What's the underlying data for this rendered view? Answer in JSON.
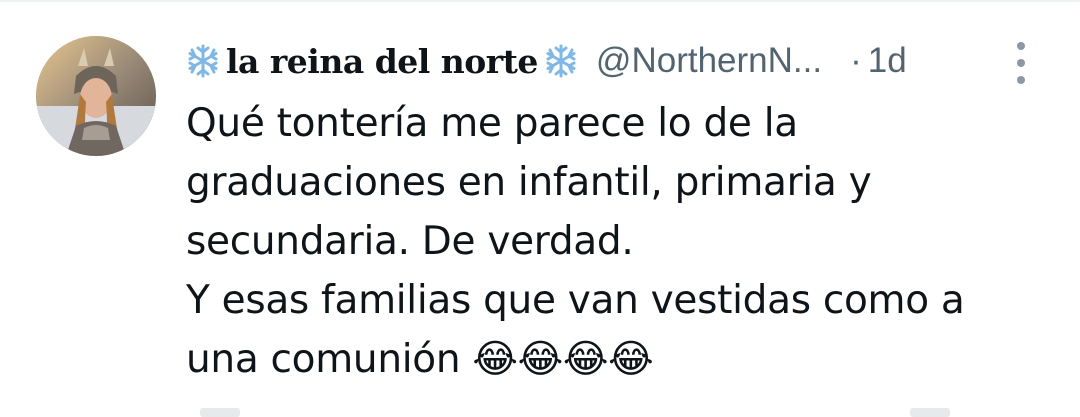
{
  "tweet": {
    "display_name": "la reina del norte",
    "name_decoration_icon": "snowflake-emoji",
    "handle": "@NorthernN...",
    "separator": "·",
    "time": "1d",
    "more_icon": "vertical-ellipsis-icon",
    "avatar_icon": "profile-photo",
    "text": "Qué tontería me parece lo de la\ngraduaciones en infantil, primaria y\nsecundaria. De verdad.\nY esas familias que van vestidas como a\nuna comunión 😂😂😂😂"
  },
  "colors": {
    "text": "#0f1419",
    "secondary_text": "#536471",
    "snowflake": "#7fb8e6"
  }
}
